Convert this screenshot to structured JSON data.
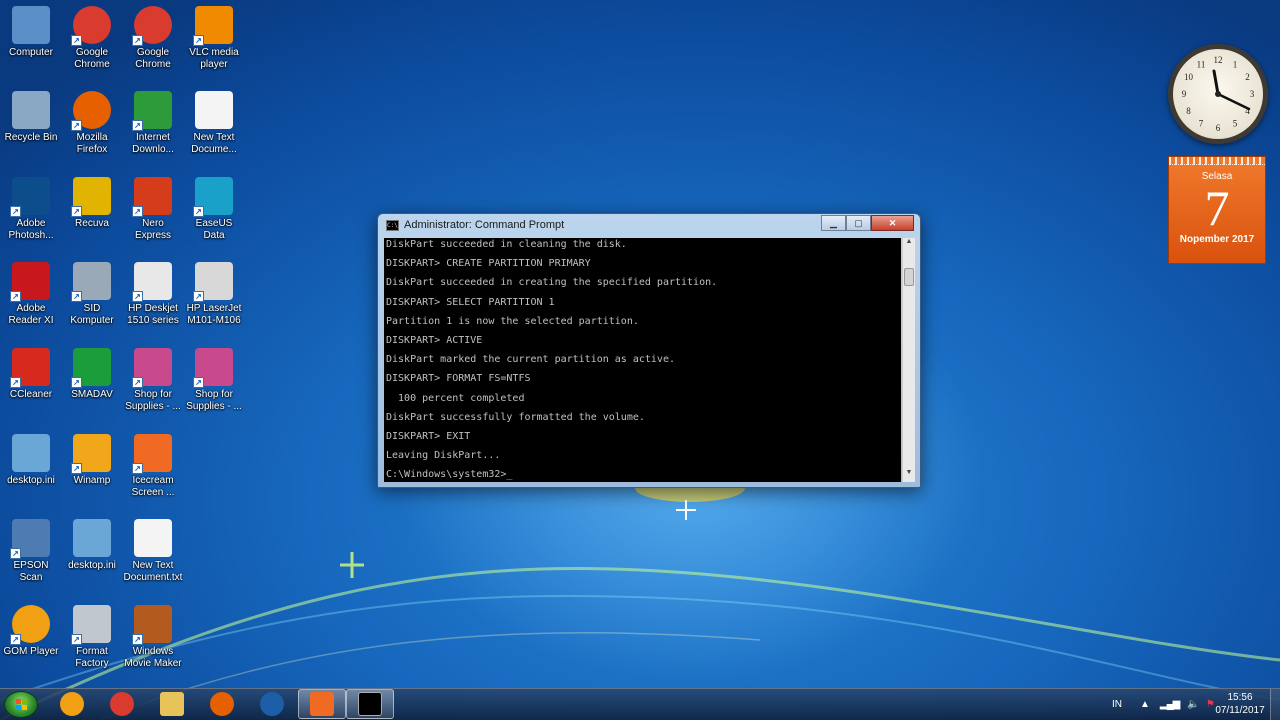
{
  "desktop": {
    "icons": [
      {
        "label": "Computer",
        "icon": "computer-icon",
        "color": "#5b8fc7"
      },
      {
        "label": "Google Chrome",
        "icon": "chrome-icon",
        "color": "#d93b2f"
      },
      {
        "label": "Google Chrome",
        "icon": "chrome-icon",
        "color": "#d93b2f"
      },
      {
        "label": "VLC media player",
        "icon": "vlc-icon",
        "color": "#f08a00"
      },
      {
        "label": "Recycle Bin",
        "icon": "recycle-bin-icon",
        "color": "#8aa7c4"
      },
      {
        "label": "Mozilla Firefox",
        "icon": "firefox-icon",
        "color": "#e66000"
      },
      {
        "label": "Internet Downlo...",
        "icon": "idm-icon",
        "color": "#2d9b3a"
      },
      {
        "label": "New Text Docume...",
        "icon": "text-document-icon",
        "color": "#f4f4f4"
      },
      {
        "label": "Adobe Photosh...",
        "icon": "photoshop-icon",
        "color": "#0c4d8c"
      },
      {
        "label": "Recuva",
        "icon": "recuva-icon",
        "color": "#e0b400"
      },
      {
        "label": "Nero Express",
        "icon": "nero-icon",
        "color": "#d43c1a"
      },
      {
        "label": "EaseUS Data Recovery ...",
        "icon": "easeus-icon",
        "color": "#1aa1c9"
      },
      {
        "label": "Adobe Reader XI",
        "icon": "adobe-reader-icon",
        "color": "#c8181e"
      },
      {
        "label": "SID Komputer",
        "icon": "monitor-icon",
        "color": "#9aa9b8"
      },
      {
        "label": "HP Deskjet 1510 series",
        "icon": "printer-icon",
        "color": "#e8e8e8"
      },
      {
        "label": "HP LaserJet M101-M106",
        "icon": "printer-icon",
        "color": "#d8d8d8"
      },
      {
        "label": "CCleaner",
        "icon": "ccleaner-icon",
        "color": "#d62a1e"
      },
      {
        "label": "SMADAV",
        "icon": "smadav-icon",
        "color": "#1a9d3a"
      },
      {
        "label": "Shop for Supplies - ...",
        "icon": "printer-shop-icon",
        "color": "#c94a8c"
      },
      {
        "label": "Shop for Supplies - ...",
        "icon": "printer-shop-icon",
        "color": "#c94a8c"
      },
      {
        "label": "desktop.ini",
        "icon": "settings-file-icon",
        "color": "#6aa6d6"
      },
      {
        "label": "Winamp",
        "icon": "winamp-icon",
        "color": "#f2a71b"
      },
      {
        "label": "Icecream Screen ...",
        "icon": "icecream-icon",
        "color": "#f06a23"
      },
      {
        "label": "EPSON Scan",
        "icon": "scanner-icon",
        "color": "#4f7bb3"
      },
      {
        "label": "desktop.ini",
        "icon": "settings-file-icon",
        "color": "#6aa6d6"
      },
      {
        "label": "New Text Document.txt",
        "icon": "text-document-icon",
        "color": "#f4f4f4"
      },
      {
        "label": "GOM Player",
        "icon": "gom-player-icon",
        "color": "#f0a012"
      },
      {
        "label": "Format Factory",
        "icon": "format-factory-icon",
        "color": "#c1c7cf"
      },
      {
        "label": "Windows Movie Maker",
        "icon": "movie-maker-icon",
        "color": "#b35b1e"
      }
    ]
  },
  "cmd": {
    "title": "Administrator: Command Prompt",
    "icon": "cmd-icon",
    "lines": [
      "DiskPart succeeded in cleaning the disk.",
      "DISKPART> CREATE PARTITION PRIMARY",
      "DiskPart succeeded in creating the specified partition.",
      "DISKPART> SELECT PARTITION 1",
      "Partition 1 is now the selected partition.",
      "DISKPART> ACTIVE",
      "DiskPart marked the current partition as active.",
      "DISKPART> FORMAT FS=NTFS",
      "  100 percent completed",
      "DiskPart successfully formatted the volume.",
      "DISKPART> EXIT",
      "Leaving DiskPart...",
      "C:\\Windows\\system32>_"
    ]
  },
  "gadgets": {
    "clock": {
      "hour_labels": [
        "12",
        "1",
        "2",
        "3",
        "4",
        "5",
        "6",
        "7",
        "8",
        "9",
        "10",
        "11"
      ]
    },
    "calendar": {
      "day": "Selasa",
      "date": "7",
      "month": "Nopember 2017"
    }
  },
  "taskbar": {
    "items": [
      {
        "name": "taskbar-gom-player",
        "icon": "gom-player-icon",
        "color": "#f0a012",
        "active": false
      },
      {
        "name": "taskbar-chrome",
        "icon": "chrome-icon",
        "color": "#d93b2f",
        "active": false
      },
      {
        "name": "taskbar-explorer",
        "icon": "folder-icon",
        "color": "#e8c35a",
        "active": false
      },
      {
        "name": "taskbar-firefox",
        "icon": "firefox-icon",
        "color": "#e66000",
        "active": false
      },
      {
        "name": "taskbar-media-player",
        "icon": "media-player-icon",
        "color": "#1c5ea8",
        "active": false
      },
      {
        "name": "taskbar-icecream",
        "icon": "icecream-icon",
        "color": "#f06a23",
        "active": true
      },
      {
        "name": "taskbar-cmd",
        "icon": "cmd-icon",
        "color": "#000000",
        "active": true
      }
    ],
    "language": "IN",
    "time": "15:56",
    "date": "07/11/2017"
  }
}
